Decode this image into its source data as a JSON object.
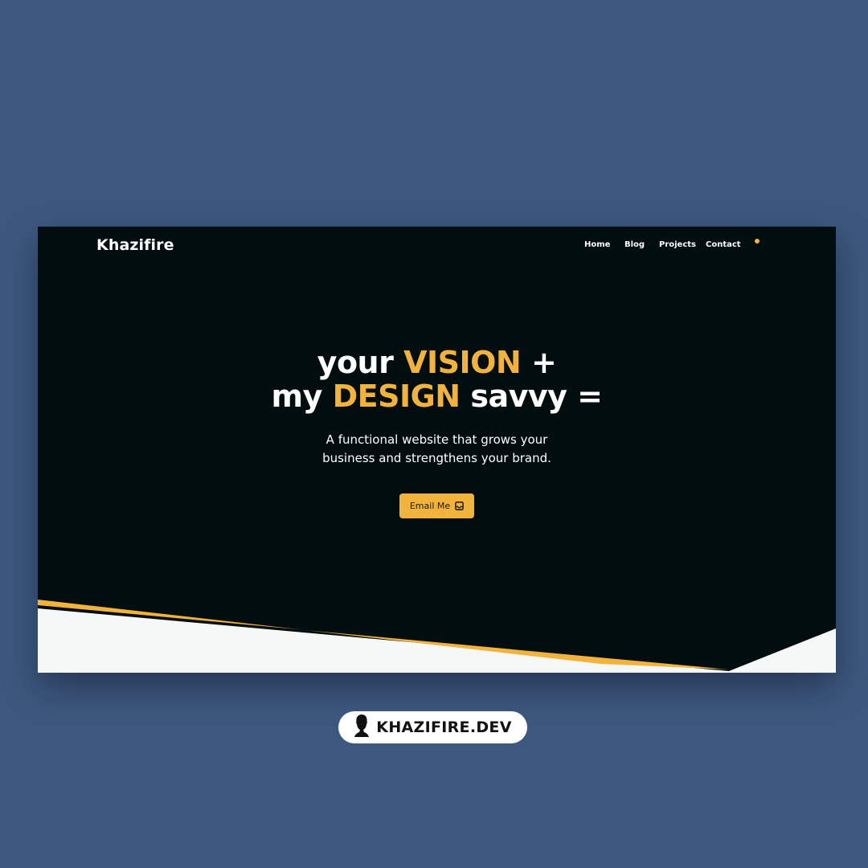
{
  "header": {
    "brand": "Khazifire",
    "nav": [
      {
        "label": "Home"
      },
      {
        "label": "Blog"
      },
      {
        "label": "Projects"
      },
      {
        "label": "Contact"
      }
    ]
  },
  "hero": {
    "line1_before": "your ",
    "line1_accent": "VISION",
    "line1_after": " +",
    "line2_before": "my ",
    "line2_accent": "DESIGN",
    "line2_after": " savvy =",
    "subtitle_line1": "A functional website that grows your",
    "subtitle_line2": "business and strengthens your brand.",
    "cta_label": "Email Me",
    "cta_icon": "inbox-icon"
  },
  "footer_badge": {
    "label": "KHAZIFIRE.DEV",
    "icon": "avatar-silhouette-icon"
  },
  "colors": {
    "page_background": "#3d587e",
    "hero_background": "#010d0e",
    "accent": "#f2b33d",
    "text": "#ffffff",
    "light_section": "#f6f8f7"
  }
}
